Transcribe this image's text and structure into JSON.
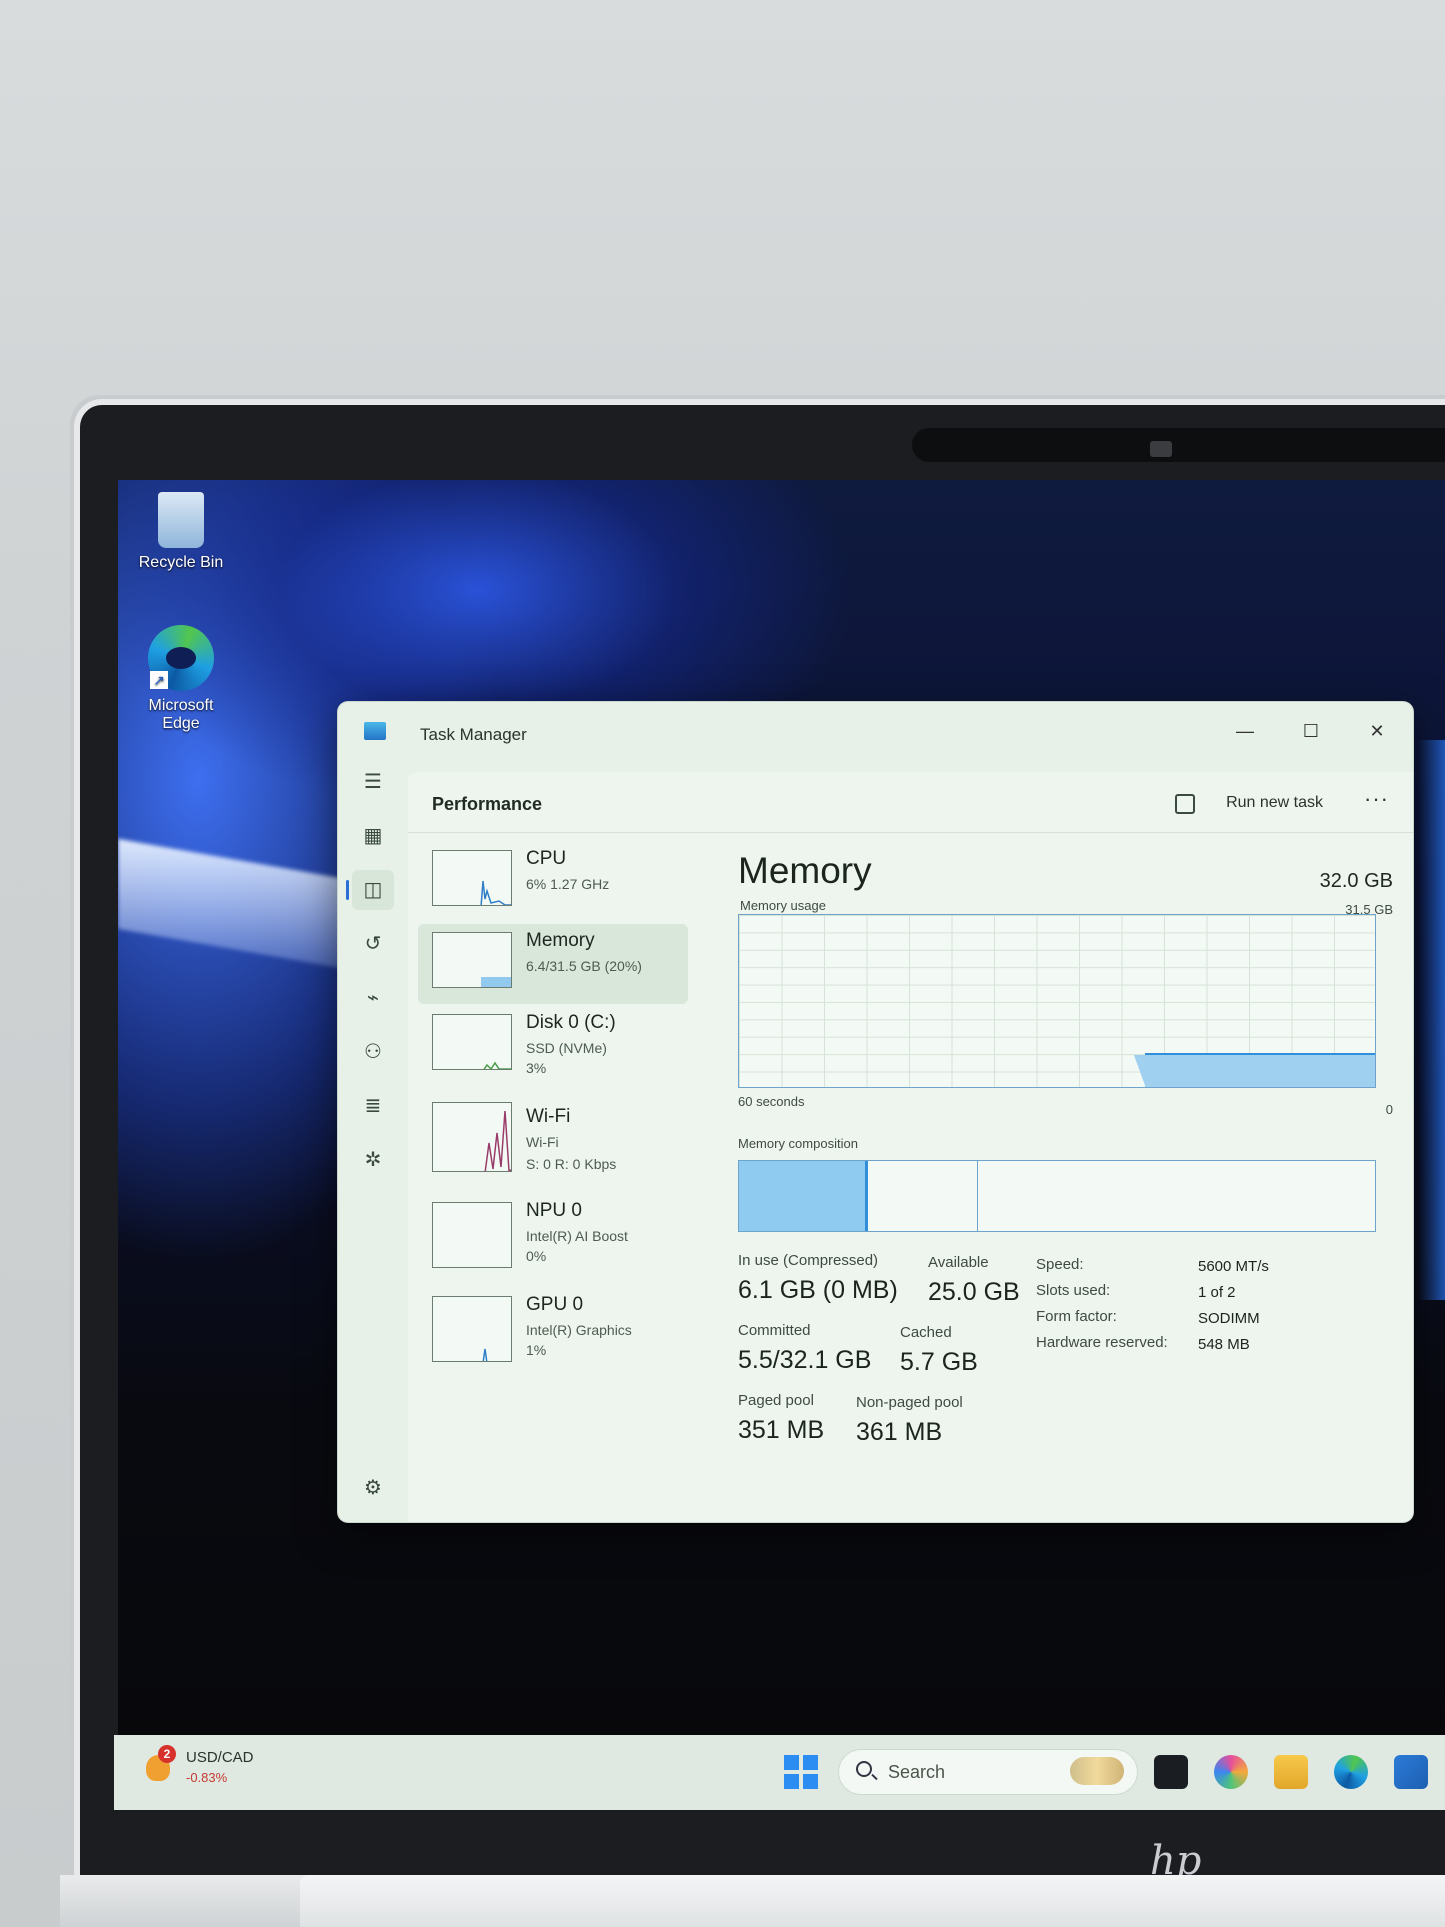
{
  "desktop": {
    "icons": [
      {
        "label": "Recycle Bin"
      },
      {
        "label": "Microsoft Edge"
      }
    ]
  },
  "window": {
    "title": "Task Manager",
    "minimize": "—",
    "maximize": "☐",
    "close": "✕"
  },
  "header": {
    "title": "Performance",
    "run_task": "Run new task",
    "more": "···"
  },
  "perf_list": [
    {
      "name": "CPU",
      "sub1": "6% 1.27 GHz",
      "sub2": ""
    },
    {
      "name": "Memory",
      "sub1": "6.4/31.5 GB (20%)",
      "sub2": ""
    },
    {
      "name": "Disk 0 (C:)",
      "sub1": "SSD (NVMe)",
      "sub2": "3%"
    },
    {
      "name": "Wi-Fi",
      "sub1": "Wi-Fi",
      "sub2": "S: 0 R: 0 Kbps"
    },
    {
      "name": "NPU 0",
      "sub1": "Intel(R) AI Boost",
      "sub2": "0%"
    },
    {
      "name": "GPU 0",
      "sub1": "Intel(R) Graphics",
      "sub2": "1%"
    }
  ],
  "detail": {
    "title": "Memory",
    "total": "32.0 GB",
    "usage_label": "Memory usage",
    "usage_max": "31.5 GB",
    "time_label": "60 seconds",
    "zero": "0",
    "composition_label": "Memory composition",
    "usage_fraction": 0.2,
    "stats": {
      "in_use_label": "In use (Compressed)",
      "in_use": "6.1 GB (0 MB)",
      "available_label": "Available",
      "available": "25.0 GB",
      "committed_label": "Committed",
      "committed": "5.5/32.1 GB",
      "cached_label": "Cached",
      "cached": "5.7 GB",
      "paged_label": "Paged pool",
      "paged": "351 MB",
      "nonpaged_label": "Non-paged pool",
      "nonpaged": "361 MB"
    },
    "specs": [
      {
        "k": "Speed:",
        "v": "5600 MT/s"
      },
      {
        "k": "Slots used:",
        "v": "1 of 2"
      },
      {
        "k": "Form factor:",
        "v": "SODIMM"
      },
      {
        "k": "Hardware reserved:",
        "v": "548 MB"
      }
    ]
  },
  "taskbar": {
    "badge": "2",
    "stock": "USD/CAD",
    "change": "-0.83%",
    "search_placeholder": "Search"
  },
  "brand": "hp"
}
